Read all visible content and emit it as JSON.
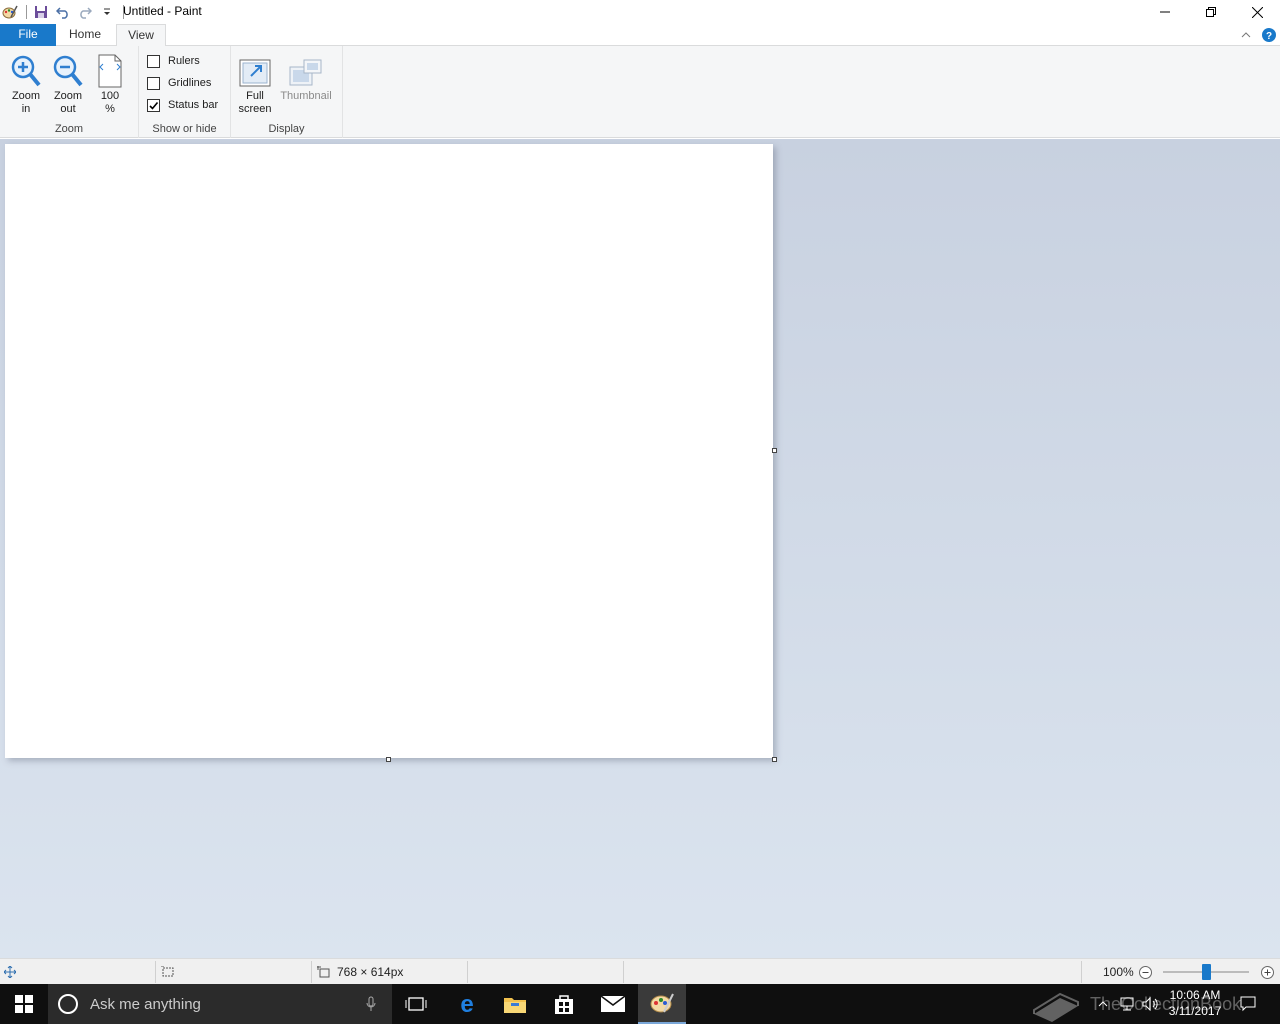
{
  "window": {
    "title": "Untitled - Paint",
    "controls": {
      "minimize": "minimize",
      "restore": "restore",
      "close": "close"
    }
  },
  "quick_access": [
    "save",
    "undo",
    "redo",
    "customize"
  ],
  "tabs": {
    "file": "File",
    "home": "Home",
    "view": "View",
    "active": "View"
  },
  "ribbon": {
    "zoom_group": {
      "label": "Zoom",
      "zoom_in": {
        "line1": "Zoom",
        "line2": "in"
      },
      "zoom_out": {
        "line1": "Zoom",
        "line2": "out"
      },
      "hundred": {
        "line1": "100",
        "line2": "%"
      }
    },
    "show_hide_group": {
      "label": "Show or hide",
      "rulers": {
        "label": "Rulers",
        "checked": false
      },
      "gridlines": {
        "label": "Gridlines",
        "checked": false
      },
      "status_bar": {
        "label": "Status bar",
        "checked": true
      }
    },
    "display_group": {
      "label": "Display",
      "full_screen": {
        "line1": "Full",
        "line2": "screen"
      },
      "thumbnail": {
        "label": "Thumbnail",
        "enabled": false
      }
    }
  },
  "canvas": {
    "size_label": "768 × 614px"
  },
  "statusbar": {
    "zoom_percent": "100%",
    "zoom_level": 100
  },
  "taskbar": {
    "search_placeholder": "Ask me anything",
    "time": "10:06 AM",
    "date": "3/11/2017",
    "watermark": "TheCollectionBook"
  },
  "colors": {
    "accent": "#1979ca",
    "workspace_top": "#c8d1e0",
    "workspace_bottom": "#dbe4ef"
  }
}
